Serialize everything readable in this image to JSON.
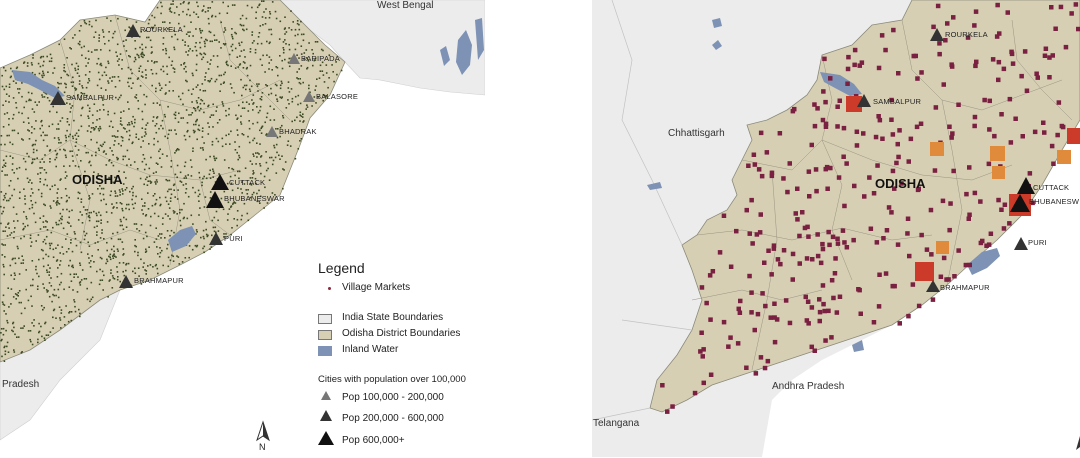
{
  "left_map": {
    "region_label": "ODISHA",
    "neighbors": {
      "west_bengal": "West Bengal",
      "pradesh": "Pradesh"
    },
    "cities": {
      "rourkela": "ROURKELA",
      "baripada": "BARIPADA",
      "sambalpur": "SAMBALPUR",
      "balasore": "BALASORE",
      "bhadrak": "BHADRAK",
      "cuttack": "CUTTACK",
      "bhubaneswar": "BHUBANESWAR",
      "puri": "PURI",
      "brahmapur": "BRAHMAPUR"
    },
    "north_arrow": "N"
  },
  "legend": {
    "title": "Legend",
    "village_markets": "Village Markets",
    "india_state": "India State Boundaries",
    "odisha_district": "Odisha District Boundaries",
    "inland_water": "Inland Water",
    "cities_heading": "Cities with population over 100,000",
    "pop_small": "Pop 100,000 - 200,000",
    "pop_medium": "Pop 200,000 - 600,000",
    "pop_large": "Pop 600,000+"
  },
  "right_map": {
    "region_label": "ODISHA",
    "neighbors": {
      "chhattisgarh": "Chhattisgarh",
      "andhra_pradesh": "Andhra Pradesh",
      "telangana": "Telangana"
    },
    "cities": {
      "rourkela": "ROURKELA",
      "sambalpur": "SAMBALPUR",
      "cuttack": "CUTTACK",
      "bhubaneswar": "BHUBANESW",
      "puri": "PURI",
      "brahmapur": "BRAHMAPUR"
    }
  },
  "colors": {
    "odisha_fill": "#d6cfb4",
    "outside_land": "#ececec",
    "water": "#7d92b4",
    "village_dot": "#3c4a22",
    "market_square": "#7a2040",
    "market_orange": "#e08a3c",
    "market_red": "#cc3b2a",
    "triangle_dark": "#111111",
    "triangle_gray": "#777777"
  }
}
